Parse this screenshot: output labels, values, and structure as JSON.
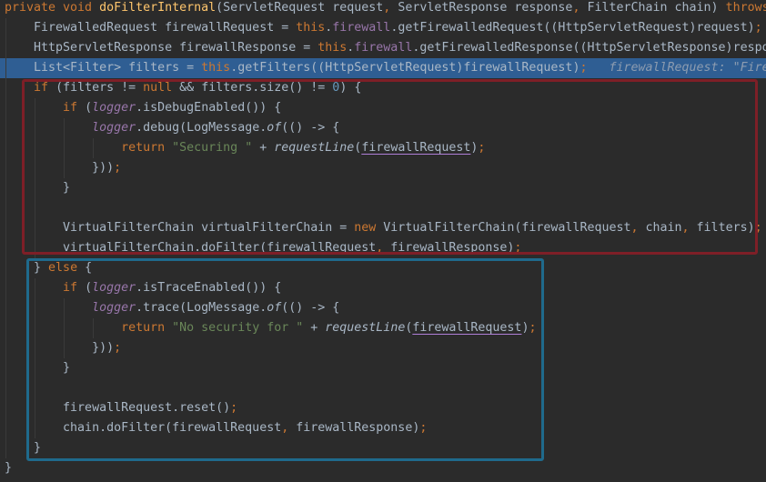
{
  "editor": {
    "highlighted_line": 3,
    "colors": {
      "background": "#2b2b2b",
      "highlight": "#2f5e93",
      "red_box": "#7e1f27",
      "blue_box": "#1f6a8c"
    },
    "lines": [
      [
        [
          "private void ",
          "k"
        ],
        [
          "doFilterInternal",
          "m"
        ],
        [
          "(ServletRequest request",
          "t"
        ],
        [
          ", ",
          "k"
        ],
        [
          "ServletResponse response",
          "t"
        ],
        [
          ", ",
          "k"
        ],
        [
          "FilterChain chain) ",
          "t"
        ],
        [
          "throws",
          "k"
        ]
      ],
      [
        [
          "    FirewalledRequest firewallRequest = ",
          "t"
        ],
        [
          "this",
          "k"
        ],
        [
          ".",
          "t"
        ],
        [
          "firewall",
          "f"
        ],
        [
          ".getFirewalledRequest((HttpServletRequest)request)",
          "t"
        ],
        [
          ";",
          "k"
        ]
      ],
      [
        [
          "    HttpServletResponse firewallResponse = ",
          "t"
        ],
        [
          "this",
          "k"
        ],
        [
          ".",
          "t"
        ],
        [
          "firewall",
          "f"
        ],
        [
          ".getFirewalledResponse((HttpServletResponse)respo",
          "t"
        ]
      ],
      [
        [
          "    List<Filter> filters = ",
          "t"
        ],
        [
          "this",
          "k"
        ],
        [
          ".getFilters((HttpServletRequest)firewallRequest)",
          "t"
        ],
        [
          ";",
          "k"
        ],
        [
          "   firewallRequest: \"Fire",
          "h"
        ]
      ],
      [
        [
          "    ",
          "t"
        ],
        [
          "if ",
          "k"
        ],
        [
          "(filters != ",
          "t"
        ],
        [
          "null ",
          "k"
        ],
        [
          "&& filters.size() != ",
          "t"
        ],
        [
          "0",
          "n"
        ],
        [
          ") {",
          "t"
        ]
      ],
      [
        [
          "        ",
          "t"
        ],
        [
          "if ",
          "k"
        ],
        [
          "(",
          "t"
        ],
        [
          "logger",
          "fi"
        ],
        [
          ".isDebugEnabled()) {",
          "t"
        ]
      ],
      [
        [
          "            ",
          "t"
        ],
        [
          "logger",
          "fi"
        ],
        [
          ".debug(LogMessage.",
          "t"
        ],
        [
          "of",
          "i"
        ],
        [
          "(() -> {",
          "t"
        ]
      ],
      [
        [
          "                ",
          "t"
        ],
        [
          "return ",
          "k"
        ],
        [
          "\"Securing \" ",
          "s"
        ],
        [
          "+ ",
          "t"
        ],
        [
          "requestLine",
          "i"
        ],
        [
          "(",
          "t"
        ],
        [
          "firewallRequest",
          "u"
        ],
        [
          ")",
          "t"
        ],
        [
          ";",
          "k"
        ]
      ],
      [
        [
          "            }))",
          "t"
        ],
        [
          ";",
          "k"
        ]
      ],
      [
        [
          "        }",
          "t"
        ]
      ],
      [],
      [
        [
          "        VirtualFilterChain virtualFilterChain = ",
          "t"
        ],
        [
          "new ",
          "k"
        ],
        [
          "VirtualFilterChain(firewallRequest",
          "t"
        ],
        [
          ", ",
          "k"
        ],
        [
          "chain",
          "t"
        ],
        [
          ", ",
          "k"
        ],
        [
          "filters)",
          "t"
        ],
        [
          ";",
          "k"
        ]
      ],
      [
        [
          "        virtualFilterChain.doFilter(firewallRequest",
          "t"
        ],
        [
          ", ",
          "k"
        ],
        [
          "firewallResponse)",
          "t"
        ],
        [
          ";",
          "k"
        ]
      ],
      [
        [
          "    } ",
          "t"
        ],
        [
          "else ",
          "k"
        ],
        [
          "{",
          "t"
        ]
      ],
      [
        [
          "        ",
          "t"
        ],
        [
          "if ",
          "k"
        ],
        [
          "(",
          "t"
        ],
        [
          "logger",
          "fi"
        ],
        [
          ".isTraceEnabled()) {",
          "t"
        ]
      ],
      [
        [
          "            ",
          "t"
        ],
        [
          "logger",
          "fi"
        ],
        [
          ".trace(LogMessage.",
          "t"
        ],
        [
          "of",
          "i"
        ],
        [
          "(() -> {",
          "t"
        ]
      ],
      [
        [
          "                ",
          "t"
        ],
        [
          "return ",
          "k"
        ],
        [
          "\"No security for \" ",
          "s"
        ],
        [
          "+ ",
          "t"
        ],
        [
          "requestLine",
          "i"
        ],
        [
          "(",
          "t"
        ],
        [
          "firewallRequest",
          "u"
        ],
        [
          ")",
          "t"
        ],
        [
          ";",
          "k"
        ]
      ],
      [
        [
          "            }))",
          "t"
        ],
        [
          ";",
          "k"
        ]
      ],
      [
        [
          "        }",
          "t"
        ]
      ],
      [],
      [
        [
          "        firewallRequest.reset()",
          "t"
        ],
        [
          ";",
          "k"
        ]
      ],
      [
        [
          "        chain.doFilter(firewallRequest",
          "t"
        ],
        [
          ", ",
          "k"
        ],
        [
          "firewallResponse)",
          "t"
        ],
        [
          ";",
          "k"
        ]
      ],
      [
        [
          "    }",
          "t"
        ]
      ],
      [
        [
          "}",
          "t"
        ]
      ]
    ]
  }
}
